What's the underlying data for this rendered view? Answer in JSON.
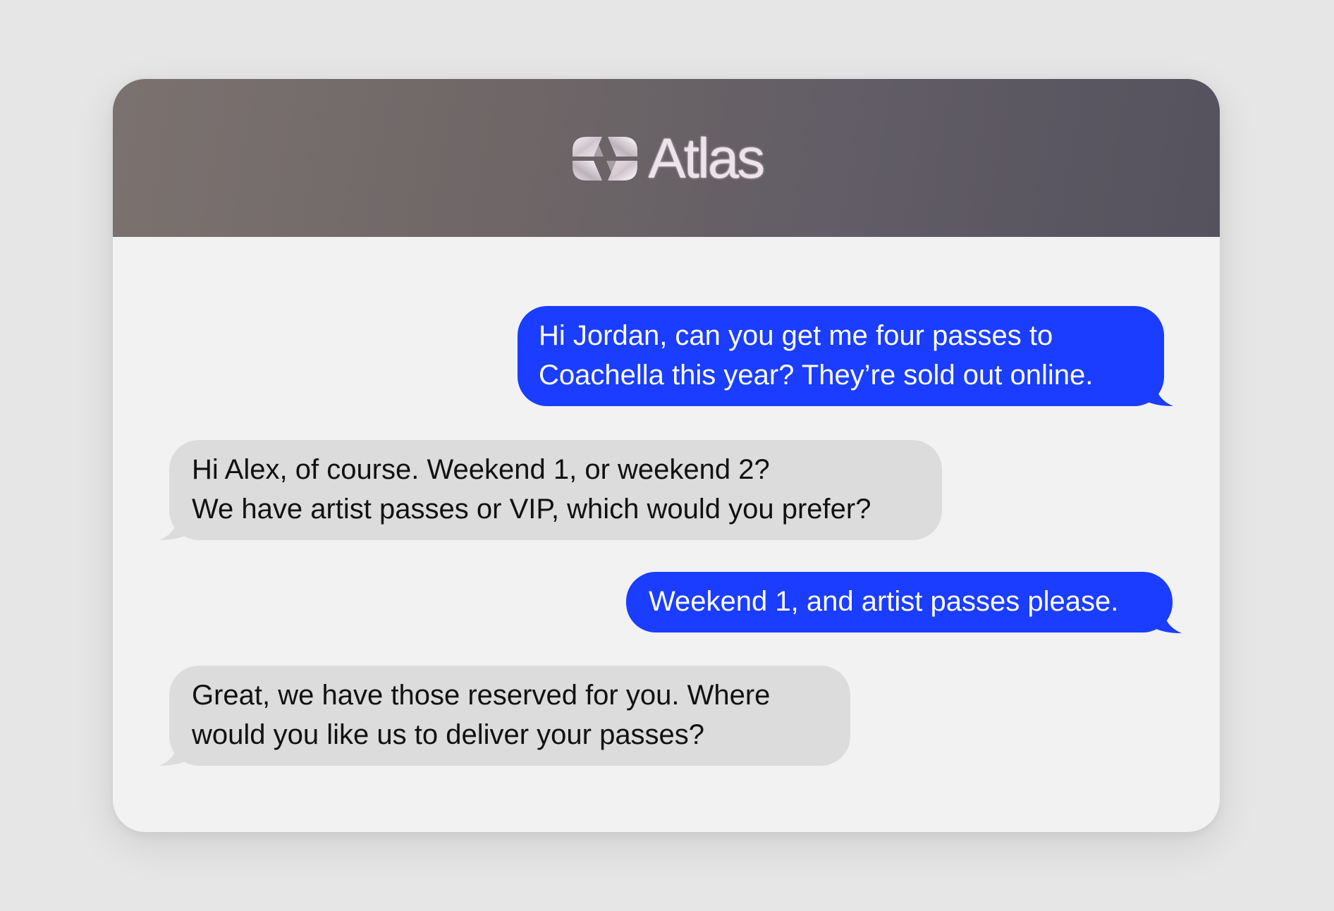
{
  "header": {
    "brand_name": "Atlas",
    "logo_icon": "atlas-logo-icon"
  },
  "colors": {
    "outgoing_bubble": "#1a3dff",
    "incoming_bubble": "#dcdcdc",
    "header_gradient_start": "#7b7270",
    "header_gradient_end": "#55525e"
  },
  "messages": [
    {
      "sender": "me",
      "lines": [
        "Hi Jordan, can you get me four passes to",
        "Coachella this year? They’re sold out online."
      ]
    },
    {
      "sender": "them",
      "lines": [
        "Hi Alex, of course. Weekend 1, or weekend 2?",
        "We have artist passes or VIP, which would you prefer?"
      ]
    },
    {
      "sender": "me",
      "lines": [
        "Weekend 1, and artist passes please."
      ]
    },
    {
      "sender": "them",
      "lines": [
        "Great, we have those reserved for you. Where",
        "would you like us to deliver your passes?"
      ]
    }
  ]
}
